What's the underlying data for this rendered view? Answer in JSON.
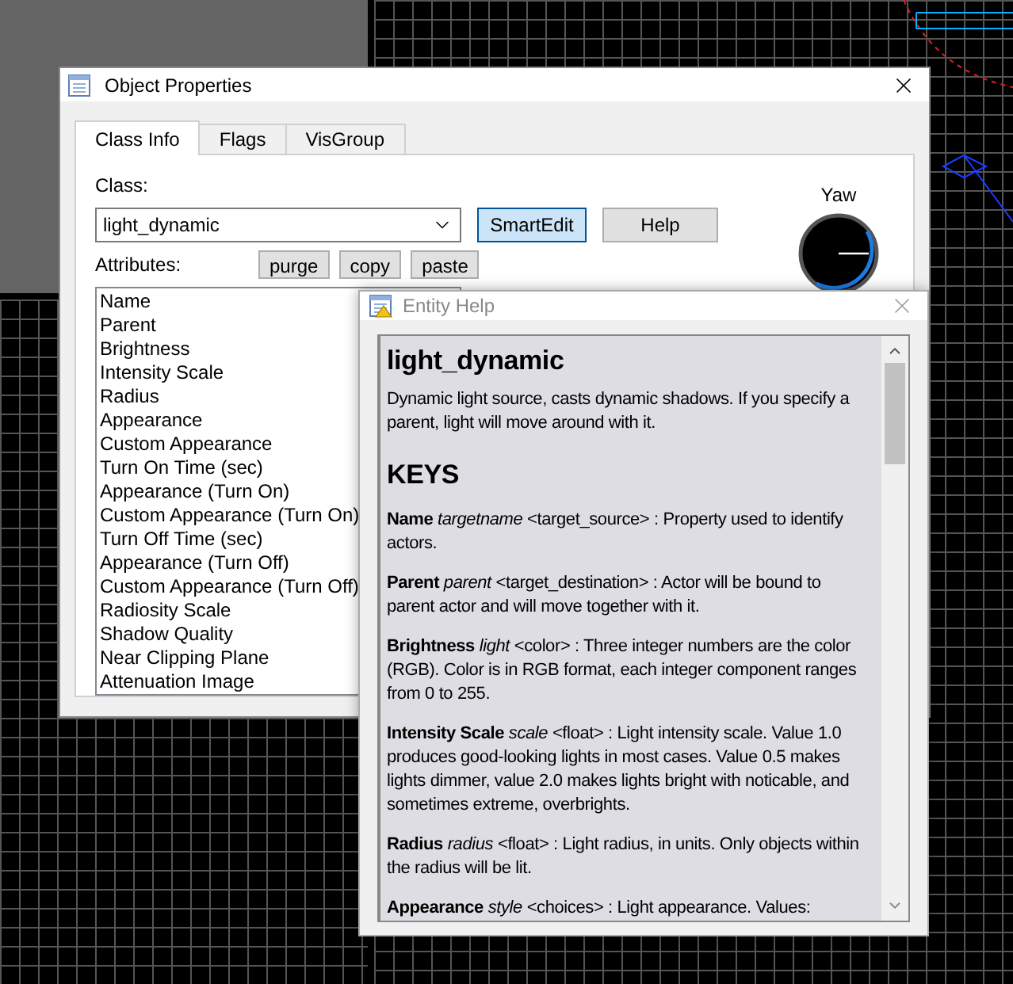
{
  "object_properties": {
    "title": "Object Properties",
    "tabs": [
      {
        "label": "Class Info",
        "selected": true
      },
      {
        "label": "Flags",
        "selected": false
      },
      {
        "label": "VisGroup",
        "selected": false
      }
    ],
    "class_label": "Class:",
    "class_value": "light_dynamic",
    "buttons": [
      "SmartEdit",
      "Help"
    ],
    "attributes_label": "Attributes:",
    "attribute_buttons": [
      "purge",
      "copy",
      "paste"
    ],
    "attributes": [
      "Name",
      "Parent",
      "Brightness",
      "Intensity Scale",
      "Radius",
      "Appearance",
      "Custom Appearance",
      "Turn On Time (sec)",
      "Appearance (Turn On)",
      "Custom Appearance (Turn On)",
      "Turn Off Time (sec)",
      "Appearance (Turn Off)",
      "Custom Appearance (Turn Off)",
      "Radiosity Scale",
      "Shadow Quality",
      "Near Clipping Plane",
      "Attenuation Image"
    ],
    "yaw_label": "Yaw"
  },
  "entity_help": {
    "title": "Entity Help",
    "heading": "light_dynamic",
    "description": "Dynamic light source, casts dynamic shadows. If you specify a parent, light will move around with it.",
    "keys_heading": "KEYS",
    "keys": [
      "**Name** *targetname* <target_source> : Property used to identify actors.",
      "**Parent** *parent* <target_destination> : Actor will be bound to parent actor and will move together with it.",
      "**Brightness** *light* <color> : Three integer numbers are the color (RGB). Color is in RGB format, each integer component ranges from 0 to 255.",
      "**Intensity Scale** *scale* <float> : Light intensity scale. Value 1.0 produces good-looking lights in most cases. Value 0.5 makes lights dimmer, value 2.0 makes lights bright with noticable, and sometimes extreme, overbrights.",
      "**Radius** *radius* <float> : Light radius, in units. Only objects within the radius will be lit.",
      "**Appearance** *style* <choices> : Light appearance. Values:"
    ]
  }
}
